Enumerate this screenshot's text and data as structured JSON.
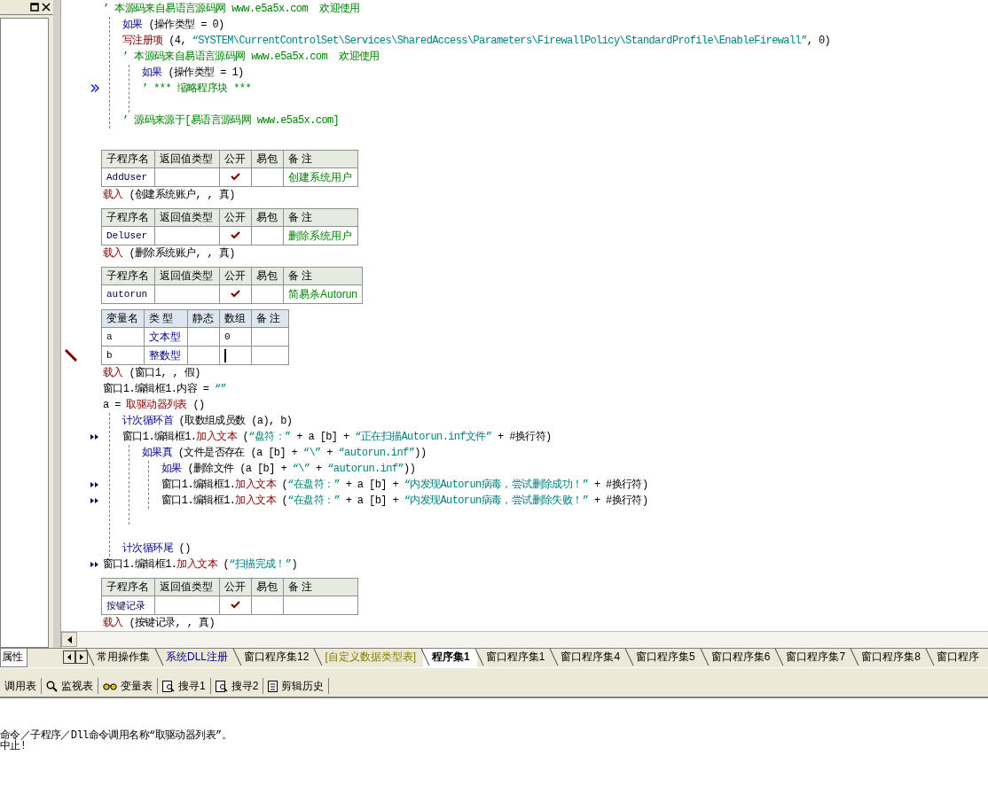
{
  "side_panel": {
    "tab": "属性"
  },
  "code": [
    {
      "kind": "line",
      "segments": [
        {
          "kind": "comment",
          "text": "’ 本源码来自易语言源码网 www.e5a5x.com  欢迎使用"
        }
      ]
    },
    {
      "kind": "block",
      "children": [
        {
          "kind": "line",
          "segments": [
            {
              "kind": "keyword",
              "text": "如果"
            },
            {
              "kind": "plain",
              "text": " (操作类型 = 0)"
            }
          ]
        },
        {
          "kind": "line",
          "segments": [
            {
              "kind": "call",
              "text": "写注册项"
            },
            {
              "kind": "plain",
              "text": " (4, "
            },
            {
              "kind": "string",
              "text": "“SYSTEM\\CurrentControlSet\\Services\\SharedAccess\\Parameters\\FirewallPolicy\\StandardProfile\\EnableFirewall”"
            },
            {
              "kind": "plain",
              "text": ", 0)"
            }
          ]
        },
        {
          "kind": "line",
          "segments": [
            {
              "kind": "comment",
              "text": "’ 本源码来自易语言源码网 www.e5a5x.com  欢迎使用"
            }
          ]
        },
        {
          "kind": "block",
          "children": [
            {
              "kind": "line",
              "segments": [
                {
                  "kind": "keyword",
                  "text": "如果"
                },
                {
                  "kind": "plain",
                  "text": " (操作类型 = 1)"
                }
              ]
            },
            {
              "kind": "line",
              "folded": true,
              "segments": [
                {
                  "kind": "comment",
                  "text": "’ *** 缩略程序块 ***"
                }
              ]
            },
            {
              "kind": "blank"
            }
          ]
        },
        {
          "kind": "line",
          "segments": [
            {
              "kind": "comment",
              "text": "’ 源码来源于[易语言源码网 www.e5a5x.com]"
            }
          ]
        }
      ]
    },
    {
      "kind": "blank"
    },
    {
      "kind": "subroutine_table",
      "columns": [
        "子程序名",
        "返回值类型",
        "公开",
        "易包",
        "备 注"
      ],
      "rows": [
        {
          "name": "AddUser",
          "public": true,
          "package": false,
          "note": "创建系统用户"
        }
      ]
    },
    {
      "kind": "line",
      "segments": [
        {
          "kind": "call",
          "text": "载入"
        },
        {
          "kind": "plain",
          "text": " (创建系统账户, , 真)"
        }
      ]
    },
    {
      "kind": "subroutine_table",
      "columns": [
        "子程序名",
        "返回值类型",
        "公开",
        "易包",
        "备 注"
      ],
      "rows": [
        {
          "name": "DelUser",
          "public": true,
          "package": false,
          "note": "删除系统用户"
        }
      ]
    },
    {
      "kind": "line",
      "segments": [
        {
          "kind": "call",
          "text": "载入"
        },
        {
          "kind": "plain",
          "text": " (删除系统账户, , 真)"
        }
      ]
    },
    {
      "kind": "subroutine_table",
      "columns": [
        "子程序名",
        "返回值类型",
        "公开",
        "易包",
        "备 注"
      ],
      "rows": [
        {
          "name": "autorun",
          "public": true,
          "package": false,
          "note": "简易杀Autorun"
        }
      ]
    },
    {
      "kind": "variable_table",
      "columns": [
        "变量名",
        "类 型",
        "静态",
        "数组",
        "备 注"
      ],
      "rows": [
        {
          "name": "a",
          "type": "文本型",
          "static": false,
          "array": "0",
          "editing": false
        },
        {
          "name": "b",
          "type": "整数型",
          "static": false,
          "editing": true
        }
      ]
    },
    {
      "kind": "line",
      "segments": [
        {
          "kind": "call",
          "text": "载入"
        },
        {
          "kind": "plain",
          "text": " (窗口1, , 假)"
        }
      ]
    },
    {
      "kind": "line",
      "segments": [
        {
          "kind": "plain",
          "text": "窗口1.编辑框1.内容 = "
        },
        {
          "kind": "string",
          "text": "“”"
        }
      ]
    },
    {
      "kind": "line",
      "segments": [
        {
          "kind": "plain",
          "text": "a = "
        },
        {
          "kind": "call",
          "text": "取驱动器列表"
        },
        {
          "kind": "plain",
          "text": " ()"
        }
      ]
    },
    {
      "kind": "block",
      "children": [
        {
          "kind": "line",
          "segments": [
            {
              "kind": "keyword",
              "text": "计次循环首"
            },
            {
              "kind": "plain",
              "text": " (取数组成员数 (a), b)"
            }
          ]
        },
        {
          "kind": "line",
          "flagged": true,
          "segments": [
            {
              "kind": "plain",
              "text": "窗口1.编辑框1."
            },
            {
              "kind": "call",
              "text": "加入文本"
            },
            {
              "kind": "plain",
              "text": " ("
            },
            {
              "kind": "string",
              "text": "“盘符：”"
            },
            {
              "kind": "plain",
              "text": " + a [b] + "
            },
            {
              "kind": "string",
              "text": "“正在扫描Autorun.inf文件”"
            },
            {
              "kind": "plain",
              "text": " + #换行符)"
            }
          ]
        },
        {
          "kind": "block",
          "children": [
            {
              "kind": "line",
              "segments": [
                {
                  "kind": "keyword",
                  "text": "如果真"
                },
                {
                  "kind": "plain",
                  "text": " (文件是否存在 (a [b] + "
                },
                {
                  "kind": "string",
                  "text": "“\\”"
                },
                {
                  "kind": "plain",
                  "text": " + "
                },
                {
                  "kind": "string",
                  "text": "“autorun.inf”"
                },
                {
                  "kind": "plain",
                  "text": "))"
                }
              ]
            },
            {
              "kind": "block",
              "children": [
                {
                  "kind": "line",
                  "segments": [
                    {
                      "kind": "keyword",
                      "text": "如果"
                    },
                    {
                      "kind": "plain",
                      "text": " (删除文件 (a [b] + "
                    },
                    {
                      "kind": "string",
                      "text": "“\\”"
                    },
                    {
                      "kind": "plain",
                      "text": " + "
                    },
                    {
                      "kind": "string",
                      "text": "“autorun.inf”"
                    },
                    {
                      "kind": "plain",
                      "text": "))"
                    }
                  ]
                },
                {
                  "kind": "line",
                  "flagged": true,
                  "segments": [
                    {
                      "kind": "plain",
                      "text": "窗口1.编辑框1."
                    },
                    {
                      "kind": "call",
                      "text": "加入文本"
                    },
                    {
                      "kind": "plain",
                      "text": " ("
                    },
                    {
                      "kind": "string",
                      "text": "“在盘符：”"
                    },
                    {
                      "kind": "plain",
                      "text": " + a [b] + "
                    },
                    {
                      "kind": "string",
                      "text": "“内发现Autorun病毒，尝试删除成功！”"
                    },
                    {
                      "kind": "plain",
                      "text": " + #换行符)"
                    }
                  ]
                },
                {
                  "kind": "line",
                  "flagged": true,
                  "segments": [
                    {
                      "kind": "plain",
                      "text": "窗口1.编辑框1."
                    },
                    {
                      "kind": "call",
                      "text": "加入文本"
                    },
                    {
                      "kind": "plain",
                      "text": " ("
                    },
                    {
                      "kind": "string",
                      "text": "“在盘符：”"
                    },
                    {
                      "kind": "plain",
                      "text": " + a [b] + "
                    },
                    {
                      "kind": "string",
                      "text": "“内发现Autorun病毒，尝试删除失败！”"
                    },
                    {
                      "kind": "plain",
                      "text": " + #换行符)"
                    }
                  ]
                }
              ]
            },
            {
              "kind": "blank"
            }
          ]
        },
        {
          "kind": "blank"
        },
        {
          "kind": "line",
          "segments": [
            {
              "kind": "keyword",
              "text": "计次循环尾"
            },
            {
              "kind": "plain",
              "text": " ()"
            }
          ]
        }
      ]
    },
    {
      "kind": "line",
      "flagged": true,
      "segments": [
        {
          "kind": "plain",
          "text": "窗口1.编辑框1."
        },
        {
          "kind": "call",
          "text": "加入文本"
        },
        {
          "kind": "plain",
          "text": " ("
        },
        {
          "kind": "string",
          "text": "“扫描完成！”"
        },
        {
          "kind": "plain",
          "text": ")"
        }
      ]
    },
    {
      "kind": "subroutine_table",
      "columns": [
        "子程序名",
        "返回值类型",
        "公开",
        "易包",
        "备 注"
      ],
      "rows": [
        {
          "name": "按键记录",
          "public": true,
          "package": false
        }
      ]
    },
    {
      "kind": "line",
      "segments": [
        {
          "kind": "call",
          "text": "载入"
        },
        {
          "kind": "plain",
          "text": " (按键记录, , 真)"
        }
      ]
    }
  ],
  "tabs": [
    {
      "label": "常用操作集",
      "kind": "module",
      "selected": false
    },
    {
      "label": "系统DLL注册",
      "kind": "dll",
      "selected": false
    },
    {
      "label": "窗口程序集12",
      "kind": "module",
      "selected": false
    },
    {
      "label": "[自定义数据类型表]",
      "kind": "datatype",
      "selected": false
    },
    {
      "label": "程序集1",
      "kind": "module",
      "selected": true
    },
    {
      "label": "窗口程序集1",
      "kind": "module",
      "selected": false
    },
    {
      "label": "窗口程序集4",
      "kind": "module",
      "selected": false
    },
    {
      "label": "窗口程序集5",
      "kind": "module",
      "selected": false
    },
    {
      "label": "窗口程序集6",
      "kind": "module",
      "selected": false
    },
    {
      "label": "窗口程序集7",
      "kind": "module",
      "selected": false
    },
    {
      "label": "窗口程序集8",
      "kind": "module",
      "selected": false
    },
    {
      "label": "窗口程序",
      "kind": "module",
      "selected": false
    }
  ],
  "toolbar": [
    {
      "label": "调用表"
    },
    {
      "label": "监视表"
    },
    {
      "label": "变量表"
    },
    {
      "label": "搜寻1"
    },
    {
      "label": "搜寻2"
    },
    {
      "label": "剪辑历史"
    }
  ],
  "output": [
    "命令／子程序／Dll命令调用名称“取驱动器列表”。",
    "中止!"
  ]
}
